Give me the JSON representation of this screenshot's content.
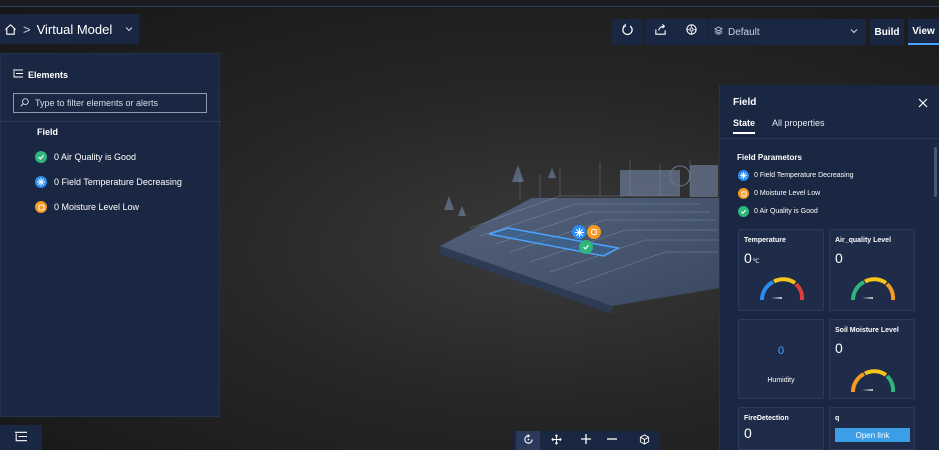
{
  "header": {
    "breadcrumb_separator": ">",
    "title": "Virtual Model",
    "home_icon": "home-icon",
    "dropdown_icon": "chevron-down-icon"
  },
  "toolbar": {
    "refresh_icon": "refresh-icon",
    "share_icon": "share-icon",
    "settings_icon": "settings-icon",
    "scene_select": {
      "icon": "layers-icon",
      "value": "Default"
    },
    "build_label": "Build",
    "view_label": "View"
  },
  "elements_panel": {
    "title": "Elements",
    "search_placeholder": "Type to filter elements or alerts",
    "group_label": "Field",
    "items": [
      {
        "label": "0 Air Quality is Good",
        "status": "good",
        "icon": "check-icon",
        "color": "#2eb67d"
      },
      {
        "label": "0 Field Temperature Decreasing",
        "status": "info",
        "icon": "snowflake-icon",
        "color": "#2d8cf0"
      },
      {
        "label": "0 Moisture Level Low",
        "status": "warning",
        "icon": "alert-icon",
        "color": "#f59a23"
      }
    ]
  },
  "field_panel": {
    "title": "Field",
    "tabs": [
      {
        "label": "State",
        "active": true
      },
      {
        "label": "All properties",
        "active": false
      }
    ],
    "section_title": "Field Parametors",
    "parameters": [
      {
        "label": "0 Field Temperature Decreasing",
        "icon": "snowflake-icon",
        "color": "#2d8cf0"
      },
      {
        "label": "0 Moisture Level Low",
        "icon": "alert-icon",
        "color": "#f59a23"
      },
      {
        "label": "0 Air Quality is Good",
        "icon": "check-icon",
        "color": "#2eb67d"
      }
    ],
    "cards": {
      "temperature": {
        "title": "Temperature",
        "value": "0",
        "unit": "℃",
        "gauge_level": 0
      },
      "air_quality": {
        "title": "Air_quality Level",
        "value": "0",
        "gauge_level": 0
      },
      "humidity": {
        "title": "Humidity",
        "value": "0"
      },
      "soil_moisture": {
        "title": "Soil Moisture Level",
        "value": "0",
        "gauge_level": 0
      },
      "fire_detection": {
        "title": "FireDetection",
        "value": "0"
      },
      "q": {
        "title": "q",
        "button_label": "Open link"
      }
    }
  },
  "nav_toolbar": {
    "orbit_icon": "orbit-icon",
    "pan_icon": "pan-icon",
    "zoom_in_icon": "plus-icon",
    "zoom_out_icon": "minus-icon",
    "reset_view_icon": "cube-icon"
  },
  "colors": {
    "panel_bg": "#1a2742",
    "accent": "#4aa3ff",
    "good": "#2eb67d",
    "info": "#2d8cf0",
    "warning": "#f59a23"
  }
}
